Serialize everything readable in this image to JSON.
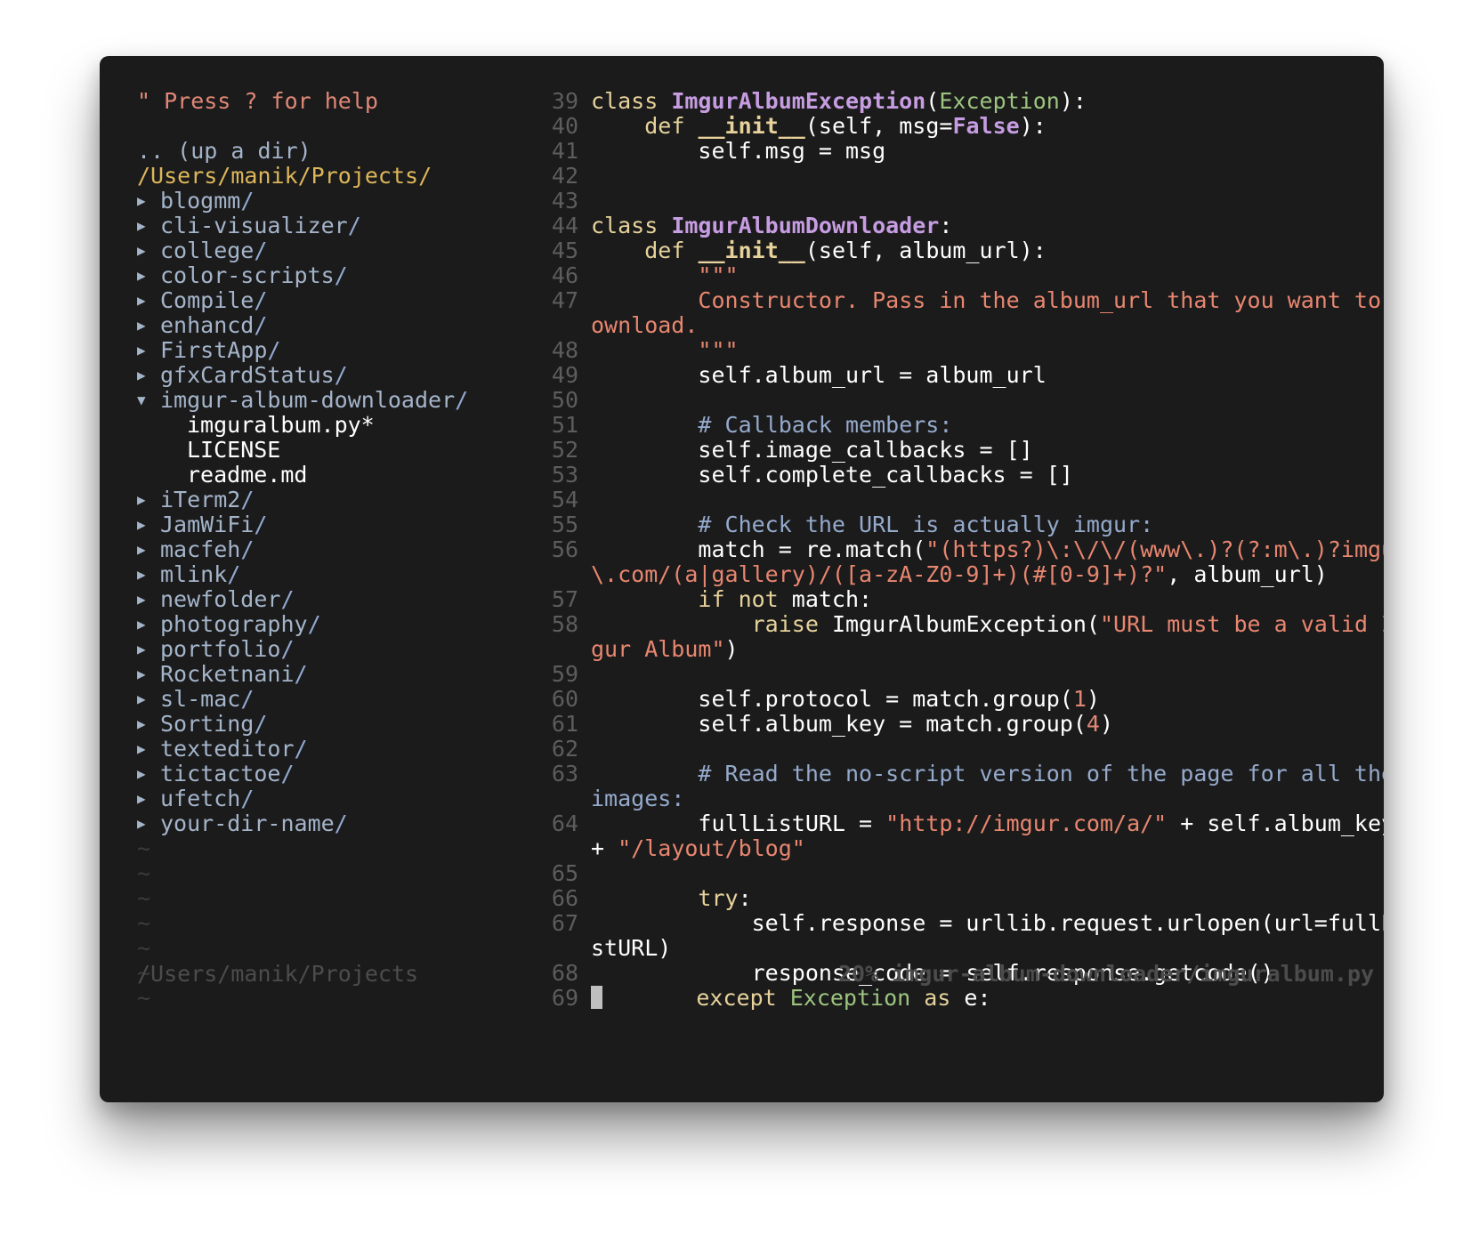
{
  "tree": {
    "help": "\" Press ? for help",
    "updir": ".. (up a dir)",
    "cwd": "/Users/manik/Projects/",
    "items": [
      {
        "name": "blogmm",
        "state": "closed"
      },
      {
        "name": "cli-visualizer",
        "state": "closed"
      },
      {
        "name": "college",
        "state": "closed"
      },
      {
        "name": "color-scripts",
        "state": "closed"
      },
      {
        "name": "Compile",
        "state": "closed"
      },
      {
        "name": "enhancd",
        "state": "closed"
      },
      {
        "name": "FirstApp",
        "state": "closed"
      },
      {
        "name": "gfxCardStatus",
        "state": "closed"
      },
      {
        "name": "imgur-album-downloader",
        "state": "open",
        "children": [
          "imguralbum.py*",
          "LICENSE",
          "readme.md"
        ]
      },
      {
        "name": "iTerm2",
        "state": "closed"
      },
      {
        "name": "JamWiFi",
        "state": "closed"
      },
      {
        "name": "macfeh",
        "state": "closed"
      },
      {
        "name": "mlink",
        "state": "closed"
      },
      {
        "name": "newfolder",
        "state": "closed"
      },
      {
        "name": "photography",
        "state": "closed"
      },
      {
        "name": "portfolio",
        "state": "closed"
      },
      {
        "name": "Rocketnani",
        "state": "closed"
      },
      {
        "name": "sl-mac",
        "state": "closed"
      },
      {
        "name": "Sorting",
        "state": "closed"
      },
      {
        "name": "texteditor",
        "state": "closed"
      },
      {
        "name": "tictactoe",
        "state": "closed"
      },
      {
        "name": "ufetch",
        "state": "closed"
      },
      {
        "name": "your-dir-name",
        "state": "closed"
      }
    ],
    "tilde_lines": 7,
    "tilde": "~",
    "status": "/Users/manik/Projects"
  },
  "editor": {
    "status": "20% imgur-album-downloader/imguralbum.py",
    "lines": [
      {
        "n": "39",
        "segs": [
          [
            "kw",
            "class "
          ],
          [
            "cls",
            "ImgurAlbumException"
          ],
          [
            "t",
            "("
          ],
          [
            "bi",
            "Exception"
          ],
          [
            "t",
            "):"
          ]
        ]
      },
      {
        "n": "40",
        "segs": [
          [
            "t",
            "    "
          ],
          [
            "kw",
            "def "
          ],
          [
            "fn",
            "__init__"
          ],
          [
            "t",
            "(self, msg="
          ],
          [
            "const",
            "False"
          ],
          [
            "t",
            "):"
          ]
        ]
      },
      {
        "n": "41",
        "segs": [
          [
            "t",
            "        self.msg = msg"
          ]
        ]
      },
      {
        "n": "42",
        "segs": []
      },
      {
        "n": "43",
        "segs": []
      },
      {
        "n": "44",
        "segs": [
          [
            "kw",
            "class "
          ],
          [
            "cls",
            "ImgurAlbumDownloader"
          ],
          [
            "t",
            ":"
          ]
        ]
      },
      {
        "n": "45",
        "segs": [
          [
            "t",
            "    "
          ],
          [
            "kw",
            "def "
          ],
          [
            "fn",
            "__init__"
          ],
          [
            "t",
            "(self, album_url):"
          ]
        ]
      },
      {
        "n": "46",
        "segs": [
          [
            "t",
            "        "
          ],
          [
            "str",
            "\"\"\""
          ]
        ]
      },
      {
        "n": "47",
        "segs": [
          [
            "t",
            "        "
          ],
          [
            "str",
            "Constructor. Pass in the album_url that you want to d"
          ]
        ]
      },
      {
        "n": "",
        "segs": [
          [
            "str",
            "ownload."
          ]
        ]
      },
      {
        "n": "48",
        "segs": [
          [
            "t",
            "        "
          ],
          [
            "str",
            "\"\"\""
          ]
        ]
      },
      {
        "n": "49",
        "segs": [
          [
            "t",
            "        self.album_url = album_url"
          ]
        ]
      },
      {
        "n": "50",
        "segs": []
      },
      {
        "n": "51",
        "segs": [
          [
            "t",
            "        "
          ],
          [
            "cm",
            "# Callback members:"
          ]
        ]
      },
      {
        "n": "52",
        "segs": [
          [
            "t",
            "        self.image_callbacks = []"
          ]
        ]
      },
      {
        "n": "53",
        "segs": [
          [
            "t",
            "        self.complete_callbacks = []"
          ]
        ]
      },
      {
        "n": "54",
        "segs": []
      },
      {
        "n": "55",
        "segs": [
          [
            "t",
            "        "
          ],
          [
            "cm",
            "# Check the URL is actually imgur:"
          ]
        ]
      },
      {
        "n": "56",
        "segs": [
          [
            "t",
            "        match = re.match("
          ],
          [
            "str",
            "\"(https?)\\:\\/\\/(www\\.)?(?:m\\.)?imgur"
          ]
        ]
      },
      {
        "n": "",
        "segs": [
          [
            "str",
            "\\.com/(a|gallery)/([a-zA-Z0-9]+)(#[0-9]+)?\""
          ],
          [
            "t",
            ", album_url)"
          ]
        ]
      },
      {
        "n": "57",
        "segs": [
          [
            "t",
            "        "
          ],
          [
            "kw",
            "if not "
          ],
          [
            "t",
            "match:"
          ]
        ]
      },
      {
        "n": "58",
        "segs": [
          [
            "t",
            "            "
          ],
          [
            "kw",
            "raise "
          ],
          [
            "t",
            "ImgurAlbumException("
          ],
          [
            "str",
            "\"URL must be a valid Im"
          ]
        ]
      },
      {
        "n": "",
        "segs": [
          [
            "str",
            "gur Album\""
          ],
          [
            "t",
            ")"
          ]
        ]
      },
      {
        "n": "59",
        "segs": []
      },
      {
        "n": "60",
        "segs": [
          [
            "t",
            "        self.protocol = match.group("
          ],
          [
            "num",
            "1"
          ],
          [
            "t",
            ")"
          ]
        ]
      },
      {
        "n": "61",
        "segs": [
          [
            "t",
            "        self.album_key = match.group("
          ],
          [
            "num",
            "4"
          ],
          [
            "t",
            ")"
          ]
        ]
      },
      {
        "n": "62",
        "segs": []
      },
      {
        "n": "63",
        "segs": [
          [
            "t",
            "        "
          ],
          [
            "cm",
            "# Read the no-script version of the page for all the"
          ]
        ]
      },
      {
        "n": "",
        "segs": [
          [
            "cm",
            "images:"
          ]
        ]
      },
      {
        "n": "64",
        "segs": [
          [
            "t",
            "        fullListURL = "
          ],
          [
            "str",
            "\"http://imgur.com/a/\""
          ],
          [
            "t",
            " + self.album_key"
          ]
        ]
      },
      {
        "n": "",
        "segs": [
          [
            "t",
            "+ "
          ],
          [
            "str",
            "\"/layout/blog\""
          ]
        ]
      },
      {
        "n": "65",
        "segs": []
      },
      {
        "n": "66",
        "segs": [
          [
            "t",
            "        "
          ],
          [
            "kw",
            "try"
          ],
          [
            "t",
            ":"
          ]
        ]
      },
      {
        "n": "67",
        "segs": [
          [
            "t",
            "            self.response = urllib.request.urlopen(url=fullLi"
          ]
        ]
      },
      {
        "n": "",
        "segs": [
          [
            "t",
            "stURL)"
          ]
        ]
      },
      {
        "n": "68",
        "segs": [
          [
            "t",
            "            response_code = self.response.getcode()"
          ]
        ]
      },
      {
        "n": "69",
        "cursor": true,
        "segs": [
          [
            "t",
            "       "
          ],
          [
            "kw",
            "except "
          ],
          [
            "bi",
            "Exception "
          ],
          [
            "kw",
            "as "
          ],
          [
            "t",
            "e:"
          ]
        ]
      }
    ]
  }
}
